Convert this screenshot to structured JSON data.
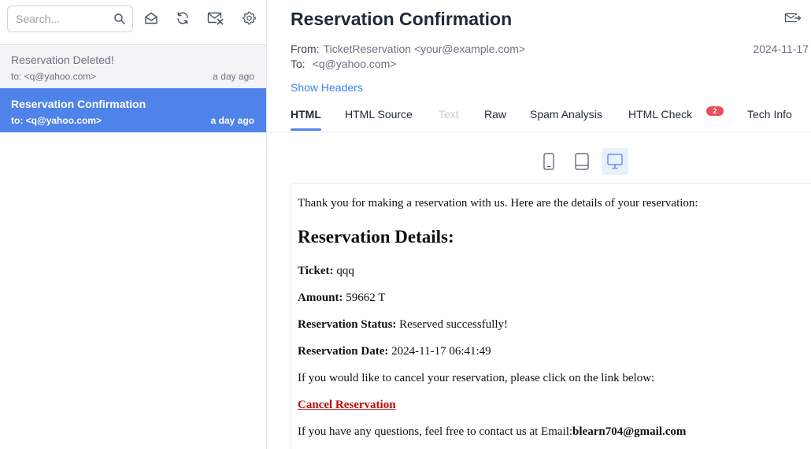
{
  "search": {
    "placeholder": "Search..."
  },
  "toolbar": {
    "icons": [
      "search-icon",
      "envelope-open-icon",
      "refresh-icon",
      "mail-delete-icon",
      "gear-icon"
    ]
  },
  "mail_list": [
    {
      "subject": "Reservation Deleted!",
      "to": "to: <q@yahoo.com>",
      "time": "a day ago",
      "active": false
    },
    {
      "subject": "Reservation Confirmation",
      "to": "to: <q@yahoo.com>",
      "time": "a day ago",
      "active": true
    }
  ],
  "message": {
    "title": "Reservation Confirmation",
    "from_label": "From:",
    "from_value": "TicketReservation <your@example.com>",
    "to_label": "To:",
    "to_value": "<q@yahoo.com>",
    "date": "2024-11-17",
    "show_headers": "Show Headers"
  },
  "tabs": [
    {
      "label": "HTML",
      "state": "active"
    },
    {
      "label": "HTML Source",
      "state": "normal"
    },
    {
      "label": "Text",
      "state": "disabled"
    },
    {
      "label": "Raw",
      "state": "normal"
    },
    {
      "label": "Spam Analysis",
      "state": "normal"
    },
    {
      "label": "HTML Check",
      "state": "normal",
      "badge": "2"
    },
    {
      "label": "Tech Info",
      "state": "normal"
    }
  ],
  "device_buttons": [
    {
      "icon": "mobile-icon",
      "active": false
    },
    {
      "icon": "tablet-icon",
      "active": false
    },
    {
      "icon": "desktop-icon",
      "active": true
    }
  ],
  "colors": {
    "accent": "#4f83ea",
    "link_red": "#b80d0d",
    "badge": "#ef4b5a"
  },
  "preview": {
    "intro": "Thank you for making a reservation with us. Here are the details of your reservation:",
    "heading": "Reservation Details:",
    "ticket_label": "Ticket:",
    "ticket_value": " qqq",
    "amount_label": "Amount:",
    "amount_value": " 59662 T",
    "status_label": "Reservation Status:",
    "status_value": " Reserved successfully!",
    "date_label": "Reservation Date:",
    "date_value": " 2024-11-17 06:41:49",
    "cancel_text": "If you would like to cancel your reservation, please click on the link below:",
    "cancel_link": "Cancel Reservation",
    "contact_text": "If you have any questions, feel free to contact us at Email:",
    "contact_email": "blearn704@gmail.com"
  }
}
